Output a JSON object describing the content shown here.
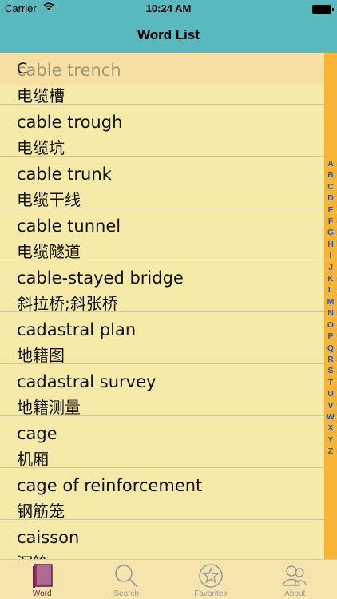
{
  "status_bar": {
    "carrier": "Carrier",
    "time": "10:24 AM"
  },
  "nav": {
    "title": "Word List"
  },
  "section": {
    "letter": "C"
  },
  "first_row_ghost": "cable trench",
  "rows": [
    {
      "en": "",
      "zh": "电缆槽"
    },
    {
      "en": "cable trough",
      "zh": "电缆坑"
    },
    {
      "en": "cable trunk",
      "zh": "电缆干线"
    },
    {
      "en": "cable tunnel",
      "zh": "电缆隧道"
    },
    {
      "en": "cable-stayed bridge",
      "zh": "斜拉桥;斜张桥"
    },
    {
      "en": "cadastral plan",
      "zh": "地籍图"
    },
    {
      "en": "cadastral survey",
      "zh": "地籍测量"
    },
    {
      "en": "cage",
      "zh": "机厢"
    },
    {
      "en": "cage of reinforcement",
      "zh": "钢筋笼"
    },
    {
      "en": "caisson",
      "zh": "沉箱"
    }
  ],
  "index": [
    "A",
    "B",
    "C",
    "D",
    "E",
    "F",
    "G",
    "H",
    "I",
    "J",
    "K",
    "L",
    "M",
    "N",
    "O",
    "P",
    "Q",
    "R",
    "S",
    "T",
    "U",
    "V",
    "W",
    "X",
    "Y",
    "Z"
  ],
  "tabs": [
    {
      "label": "Word",
      "icon": "book-icon",
      "active": true
    },
    {
      "label": "Search",
      "icon": "magnifier-icon",
      "active": false
    },
    {
      "label": "Favorites",
      "icon": "star-icon",
      "active": false
    },
    {
      "label": "About",
      "icon": "people-icon",
      "active": false
    }
  ],
  "colors": {
    "header": "#58b9bf",
    "background": "#f5eaa8",
    "index_bar": "#f8b535",
    "index_text": "#1e5bd3",
    "active_tab": "#7d2250"
  }
}
